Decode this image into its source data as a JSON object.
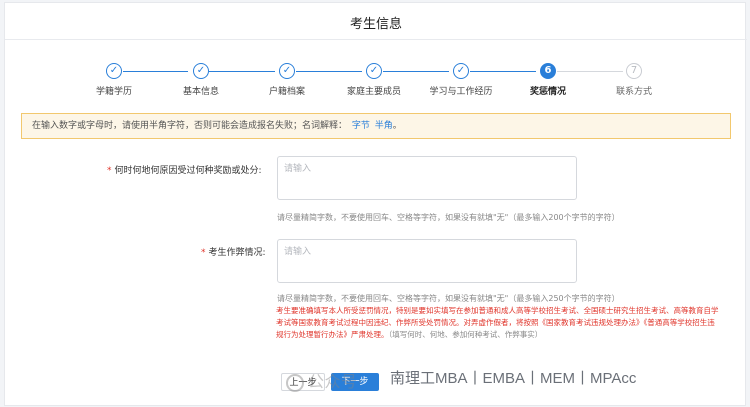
{
  "page": {
    "title": "考生信息"
  },
  "steps": [
    {
      "label": "学籍学历",
      "state": "done",
      "mark": "✓"
    },
    {
      "label": "基本信息",
      "state": "done",
      "mark": "✓"
    },
    {
      "label": "户籍档案",
      "state": "done",
      "mark": "✓"
    },
    {
      "label": "家庭主要成员",
      "state": "done",
      "mark": "✓"
    },
    {
      "label": "学习与工作经历",
      "state": "done",
      "mark": "✓"
    },
    {
      "label": "奖惩情况",
      "state": "active",
      "mark": "6"
    },
    {
      "label": "联系方式",
      "state": "pending",
      "mark": "7"
    }
  ],
  "notice": {
    "text": "在输入数字或字母时，请使用半角字符，否则可能会造成报名失败；名词解释：",
    "link1": "字节",
    "link2": "半角",
    "suffix": "。"
  },
  "form": {
    "reward": {
      "label": "何时何地何原因受过何种奖励或处分:",
      "placeholder": "请输入",
      "hint": "请尽量精简字数，不要使用回车、空格等字符，如果没有就填\"无\"（最多输入200个字节的字符）"
    },
    "cheating": {
      "label": "考生作弊情况:",
      "placeholder": "请输入",
      "hint": "请尽量精简字数，不要使用回车、空格等字符，如果没有就填\"无\"（最多输入250个字节的字符）",
      "warning": "考生要准确填写本人所受惩罚情况，特别是要如实填写在参加普通和成人高等学校招生考试、全国硕士研究生招生考试、高等教育自学考试等国家教育考试过程中因违纪、作弊所受处罚情况。对弄虚作假者，将按照《国家教育考试违规处理办法》《普通高等学校招生违规行为处理暂行办法》严肃处理。",
      "warning_note": "（填写何时、何地、参加何种考试、作弊事实）"
    }
  },
  "buttons": {
    "prev": "上一步",
    "next": "下一步"
  },
  "watermark": {
    "text": "公众号·",
    "brand": "南理工MBA丨EMBA丨MEM丨MPAcc"
  },
  "colors": {
    "accent": "#2a7fd9",
    "required": "#e0352b",
    "notice_bg": "#fdf6e7"
  }
}
